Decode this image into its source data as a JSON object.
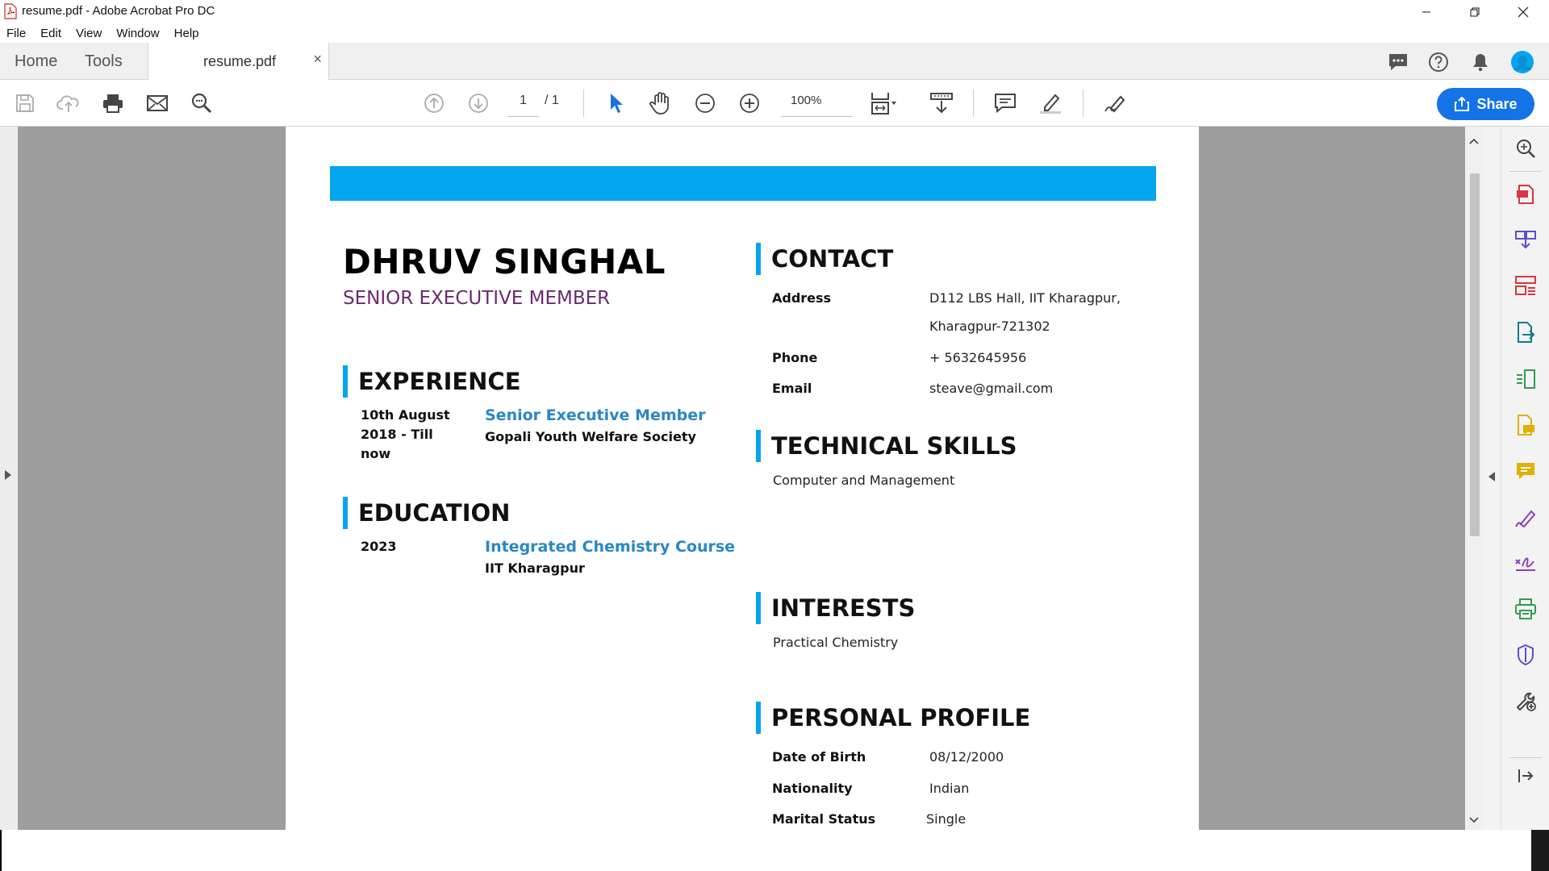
{
  "window": {
    "title": "resume.pdf - Adobe Acrobat Pro DC"
  },
  "menu": [
    "File",
    "Edit",
    "View",
    "Window",
    "Help"
  ],
  "tabs": {
    "home": "Home",
    "tools": "Tools",
    "document": "resume.pdf",
    "close": "×"
  },
  "toolbar": {
    "page_current": "1",
    "page_total": "/ 1",
    "zoom": "100%",
    "share": "Share"
  },
  "resume": {
    "name": "DHRUV SINGHAL",
    "title": "SENIOR EXECUTIVE MEMBER",
    "experience": {
      "heading": "EXPERIENCE",
      "date_line1": "10th August",
      "date_line2": "2018 - Till",
      "date_line3": "now",
      "role": "Senior Executive Member",
      "org": "Gopali Youth Welfare Society"
    },
    "education": {
      "heading": "EDUCATION",
      "year": "2023",
      "course": "Integrated Chemistry Course",
      "institute": "IIT Kharagpur"
    },
    "contact": {
      "heading": "CONTACT",
      "address_label": "Address",
      "address_line1": "D112 LBS Hall, IIT Kharagpur,",
      "address_line2": "Kharagpur-721302",
      "phone_label": "Phone",
      "phone": "+ 5632645956",
      "email_label": "Email",
      "email": "steave@gmail.com"
    },
    "skills": {
      "heading": "TECHNICAL SKILLS",
      "text": "Computer and Management"
    },
    "interests": {
      "heading": "INTERESTS",
      "text": "Practical Chemistry"
    },
    "profile": {
      "heading": "PERSONAL PROFILE",
      "dob_label": "Date of Birth",
      "dob": "08/12/2000",
      "nationality_label": "Nationality",
      "nationality": "Indian",
      "marital_label": "Marital Status",
      "marital": "Single"
    }
  },
  "colors": {
    "accent": "#04a5ef",
    "share": "#1473e6",
    "title_purple": "#6a2a70",
    "link_blue": "#2b87c4"
  }
}
